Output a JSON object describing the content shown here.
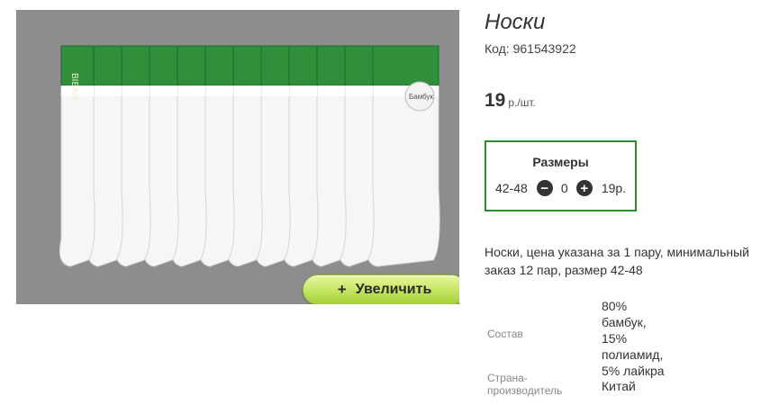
{
  "product": {
    "title": "Носки",
    "code_label": "Код:",
    "code": "961543922",
    "price": "19",
    "price_unit": "р./шт.",
    "zoom_button": "Увеличить",
    "photo_brand": "BIBAR",
    "photo_tag": "Бамбук"
  },
  "sizes": {
    "title": "Размеры",
    "rows": [
      {
        "size": "42-48",
        "quantity": "0",
        "price": "19р."
      }
    ]
  },
  "description": "Носки, цена указана за 1 пару, минимальный заказ 12 пар, размер 42-48",
  "specs": [
    {
      "label": "Состав",
      "value": "80%\nбамбук,\n15%\nполиамид,\n5% лайкра"
    },
    {
      "label": "Страна-производитель",
      "value": "Китай"
    }
  ],
  "colors": {
    "accent_green": "#2e8b2e",
    "button_green": "#c9e86a",
    "photo_background": "#8d8d8f"
  }
}
